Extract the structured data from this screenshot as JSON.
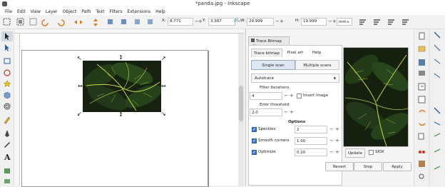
{
  "window": {
    "title": "*panda.jpg - Inkscape"
  },
  "menu": [
    "File",
    "Edit",
    "View",
    "Layer",
    "Object",
    "Path",
    "Text",
    "Filters",
    "Extensions",
    "Help"
  ],
  "coords": {
    "x_label": "X:",
    "x_value": "8.771",
    "y_label": "Y:",
    "y_value": "3.387",
    "w_label": "W:",
    "w_value": "29.999",
    "h_label": "H:",
    "h_value": "19.999",
    "unit": "mm"
  },
  "dock": {
    "tab_label": "Trace Bitmap",
    "tabs": [
      "Trace bitmap",
      "Pixel art",
      "Help"
    ],
    "scan_modes": [
      "Single scan",
      "Multiple scans"
    ],
    "mode_select": "Autotrace",
    "filter_iterations_label": "Filter iterations",
    "filter_iterations_value": "4",
    "invert_label": "Invert image",
    "error_threshold_label": "Error threshold",
    "error_threshold_value": "2.0",
    "options_label": "Options",
    "speckles_label": "Speckles",
    "speckles_value": "2",
    "smooth_label": "Smooth corners",
    "smooth_value": "1.00",
    "optimize_label": "Optimize",
    "optimize_value": "0.20",
    "update_label": "Update",
    "siox_label": "SIOX",
    "revert_label": "Revert",
    "stop_label": "Stop",
    "apply_label": "Apply"
  },
  "colors": {
    "accent": "#3a7bd5",
    "leaf_dark": "#1c2a18",
    "leaf_light": "#c9d64a"
  }
}
